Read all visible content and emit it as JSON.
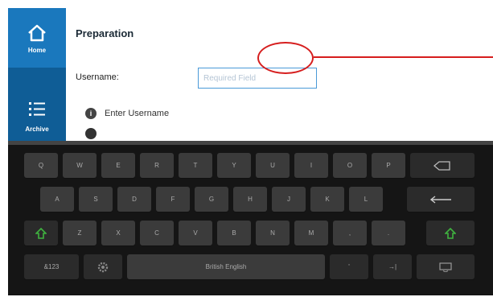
{
  "sidebar": {
    "items": [
      {
        "label": "Home",
        "icon": "home-icon"
      },
      {
        "label": "Archive",
        "icon": "list-icon"
      }
    ]
  },
  "form": {
    "title": "Preparation",
    "username_label": "Username:",
    "username_placeholder": "Required Field",
    "hint": "Enter Username"
  },
  "keyboard": {
    "row1": [
      "Q",
      "W",
      "E",
      "R",
      "T",
      "Y",
      "U",
      "I",
      "O",
      "P"
    ],
    "row2": [
      "A",
      "S",
      "D",
      "F",
      "G",
      "H",
      "J",
      "K",
      "L"
    ],
    "row3": [
      "Z",
      "X",
      "C",
      "V",
      "B",
      "N",
      "M",
      ",",
      "."
    ],
    "mode_key": "&123",
    "space": "British English",
    "apostrophe": "'",
    "tab_key": "→|"
  },
  "colors": {
    "sidebar": "#0f5d96",
    "sidebar_active": "#1a78bd",
    "input_border": "#4a9ad8",
    "callout": "#d61e1e",
    "shift_green": "#3fb23f"
  }
}
